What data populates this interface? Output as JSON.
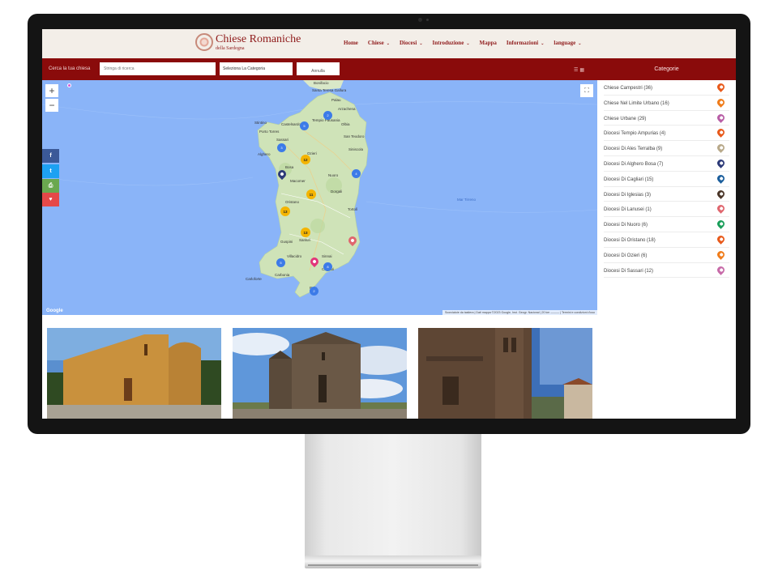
{
  "header": {
    "logo_title": "Chiese Romaniche",
    "logo_sub": "della Sardegna",
    "nav": [
      {
        "label": "Home",
        "has_dropdown": false
      },
      {
        "label": "Chiese",
        "has_dropdown": true
      },
      {
        "label": "Diocesi",
        "has_dropdown": true
      },
      {
        "label": "Introduzione",
        "has_dropdown": true
      },
      {
        "label": "Mappa",
        "has_dropdown": false
      },
      {
        "label": "Informazioni",
        "has_dropdown": true
      },
      {
        "label": "language",
        "has_dropdown": true
      }
    ]
  },
  "search": {
    "label": "Cerca la tua chiesa",
    "placeholder": "Stringa di ricerca",
    "category_select": "Seleziona La Categoria",
    "cancel_label": "Annulla",
    "categories_title": "Categorie"
  },
  "map": {
    "zoom_in": "+",
    "zoom_out": "−",
    "fullscreen_glyph": "⛶",
    "sea_label": "Mar Tirreno",
    "google": "Google",
    "footer": "Scorciatoie da tastiera | Dati mappa ©2023 Google, Inst. Geogr. Nacional | 20 km ——— | Termini e condizioni d'uso",
    "places": [
      {
        "name": "Bonifacio"
      },
      {
        "name": "Santa Teresa Gallura"
      },
      {
        "name": "Palau"
      },
      {
        "name": "Arzachena"
      },
      {
        "name": "Stintino"
      },
      {
        "name": "Castelsardo"
      },
      {
        "name": "Tempio Pausania"
      },
      {
        "name": "Olbia"
      },
      {
        "name": "Porto Torres"
      },
      {
        "name": "Sassari"
      },
      {
        "name": "San Teodoro"
      },
      {
        "name": "Alghero"
      },
      {
        "name": "Ozieri"
      },
      {
        "name": "Siniscola"
      },
      {
        "name": "Bosa"
      },
      {
        "name": "Macomer"
      },
      {
        "name": "Nuoro"
      },
      {
        "name": "Dorgali"
      },
      {
        "name": "Oristano"
      },
      {
        "name": "Tortolì"
      },
      {
        "name": "Guspini"
      },
      {
        "name": "Sanluri"
      },
      {
        "name": "Villacidro"
      },
      {
        "name": "Sinnai"
      },
      {
        "name": "Carbonia"
      },
      {
        "name": "Cagliari"
      },
      {
        "name": "Carloforte"
      },
      {
        "name": "Pula"
      }
    ],
    "clusters": [
      {
        "value": "2",
        "color": "blue"
      },
      {
        "value": "5",
        "color": "blue"
      },
      {
        "value": "3",
        "color": "blue"
      },
      {
        "value": "12",
        "color": "yellow"
      },
      {
        "value": "4",
        "color": "blue"
      },
      {
        "value": "11",
        "color": "yellow"
      },
      {
        "value": "13",
        "color": "yellow"
      },
      {
        "value": "13",
        "color": "yellow"
      },
      {
        "value": "5",
        "color": "blue"
      },
      {
        "value": "8",
        "color": "blue"
      },
      {
        "value": "2",
        "color": "blue"
      }
    ]
  },
  "social": [
    {
      "icon": "facebook-icon",
      "glyph": "f",
      "color": "#3b5998"
    },
    {
      "icon": "twitter-icon",
      "glyph": "t",
      "color": "#1da1f2"
    },
    {
      "icon": "print-icon",
      "glyph": "⎙",
      "color": "#6aa84f"
    },
    {
      "icon": "heart-icon",
      "glyph": "♥",
      "color": "#e54848"
    }
  ],
  "categories": [
    {
      "label": "Chiese Campestri (36)",
      "color": "#e8591a"
    },
    {
      "label": "Chiese Nel Limite Urbano (16)",
      "color": "#f07c1a"
    },
    {
      "label": "Chiese Urbane (29)",
      "color": "#b85ea6"
    },
    {
      "label": "Diocesi Tempio Ampurias (4)",
      "color": "#e8591a"
    },
    {
      "label": "Diocesi Di Ales Terralba (9)",
      "color": "#b8a98a"
    },
    {
      "label": "Diocesi Di Alghero Bosa (7)",
      "color": "#2d3a78"
    },
    {
      "label": "Diocesi Di Cagliari (15)",
      "color": "#1b5e9c"
    },
    {
      "label": "Diocesi Di Iglesias (3)",
      "color": "#4a3528"
    },
    {
      "label": "Diocesi Di Lanusei (1)",
      "color": "#e0666e"
    },
    {
      "label": "Diocesi Di Nuoro (6)",
      "color": "#1a9e5a"
    },
    {
      "label": "Diocesi Di Oristano (18)",
      "color": "#e8591a"
    },
    {
      "label": "Diocesi Di Ozieri (6)",
      "color": "#f07c1a"
    },
    {
      "label": "Diocesi Di Sassari (12)",
      "color": "#c76aa8"
    }
  ]
}
